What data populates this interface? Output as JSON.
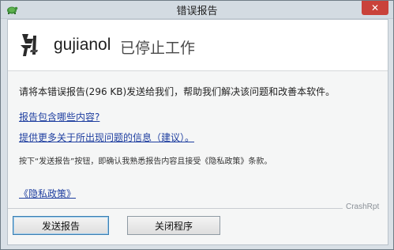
{
  "window": {
    "title": "错误报告",
    "close_glyph": "✕"
  },
  "header": {
    "app_name": "gujianol",
    "status": "已停止工作"
  },
  "body": {
    "message": "请将本错误报告(296 KB)发送给我们，帮助我们解决该问题和改善本软件。",
    "link_report_contents": "报告包含哪些内容?",
    "link_more_info": "提供更多关于所出现问题的信息（建议）。",
    "note": "按下“发送报告”按钮，即确认我熟悉报告内容且接受《隐私政策》条款。",
    "link_privacy": "《隐私政策》"
  },
  "footer": {
    "brand": "CrashRpt"
  },
  "buttons": {
    "send": "发送报告",
    "close_program": "关闭程序"
  },
  "colors": {
    "link": "#1f3fa0",
    "close_button": "#c9423a"
  },
  "icons": {
    "app_icon": "turtle-app-icon",
    "logo": "calligraphy-logo-icon"
  }
}
